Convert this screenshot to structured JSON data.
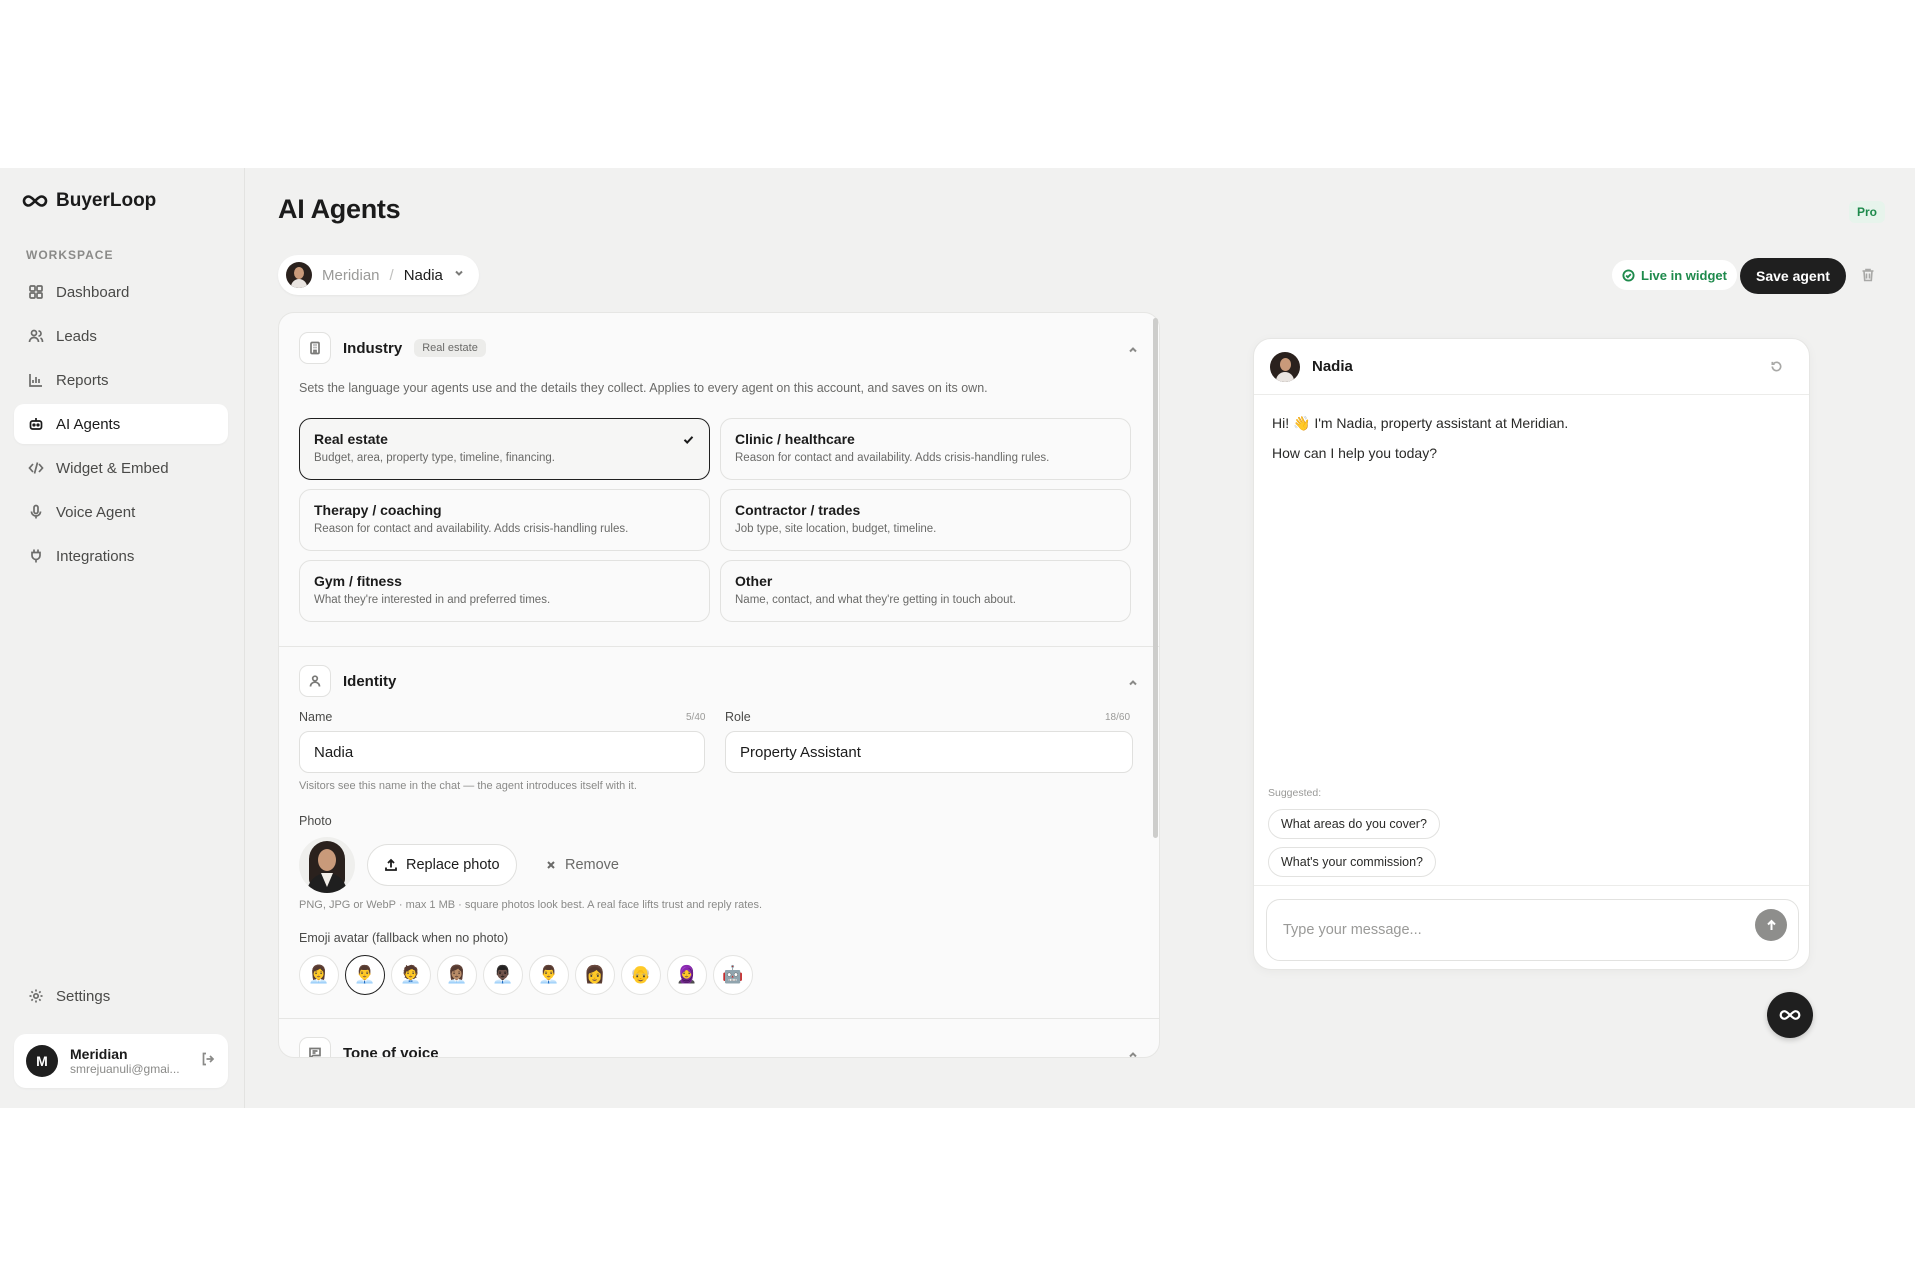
{
  "brand": {
    "name": "BuyerLoop"
  },
  "sidebar": {
    "section_label": "WORKSPACE",
    "items": [
      {
        "label": "Dashboard",
        "icon": "grid-icon"
      },
      {
        "label": "Leads",
        "icon": "users-icon"
      },
      {
        "label": "Reports",
        "icon": "bar-chart-icon"
      },
      {
        "label": "AI Agents",
        "icon": "bot-icon",
        "active": true
      },
      {
        "label": "Widget & Embed",
        "icon": "code-icon"
      },
      {
        "label": "Voice Agent",
        "icon": "mic-icon"
      },
      {
        "label": "Integrations",
        "icon": "plug-icon"
      }
    ],
    "settings_label": "Settings",
    "user": {
      "initial": "M",
      "name": "Meridian",
      "email": "smrejuanuli@gmai..."
    }
  },
  "header": {
    "title": "AI Agents",
    "plan": "Pro",
    "breadcrumb": {
      "workspace": "Meridian",
      "separator": "/",
      "agent": "Nadia"
    },
    "live_label": "Live in widget",
    "save_label": "Save agent"
  },
  "industry": {
    "title": "Industry",
    "tag": "Real estate",
    "description": "Sets the language your agents use and the details they collect. Applies to every agent on this account, and saves on its own.",
    "options": [
      {
        "title": "Real estate",
        "desc": "Budget, area, property type, timeline, financing.",
        "selected": true
      },
      {
        "title": "Clinic / healthcare",
        "desc": "Reason for contact and availability. Adds crisis-handling rules."
      },
      {
        "title": "Therapy / coaching",
        "desc": "Reason for contact and availability. Adds crisis-handling rules."
      },
      {
        "title": "Contractor / trades",
        "desc": "Job type, site location, budget, timeline."
      },
      {
        "title": "Gym / fitness",
        "desc": "What they're interested in and preferred times."
      },
      {
        "title": "Other",
        "desc": "Name, contact, and what they're getting in touch about."
      }
    ]
  },
  "identity": {
    "title": "Identity",
    "name_label": "Name",
    "name_counter": "5/40",
    "name_value": "Nadia",
    "role_label": "Role",
    "role_counter": "18/60",
    "role_value": "Property Assistant",
    "name_hint": "Visitors see this name in the chat — the agent introduces itself with it.",
    "photo_label": "Photo",
    "replace_label": "Replace photo",
    "remove_label": "Remove",
    "photo_hint": "PNG, JPG or WebP · max 1 MB · square photos look best. A real face lifts trust and reply rates.",
    "emoji_label": "Emoji avatar (fallback when no photo)",
    "emojis": [
      "👩‍💼",
      "👨‍💼",
      "🧑‍💼",
      "👩🏽‍💼",
      "👨🏿‍💼",
      "👨‍💼",
      "👩",
      "👴",
      "🧕",
      "🤖"
    ],
    "emoji_selected": 1
  },
  "tone": {
    "title": "Tone of voice"
  },
  "chat": {
    "agent_name": "Nadia",
    "greeting": "Hi! 👋 I'm Nadia, property assistant at Meridian.",
    "question": "How can I help you today?",
    "suggested_label": "Suggested:",
    "suggestions": [
      "What areas do you cover?",
      "What's your commission?"
    ],
    "placeholder": "Type your message..."
  }
}
